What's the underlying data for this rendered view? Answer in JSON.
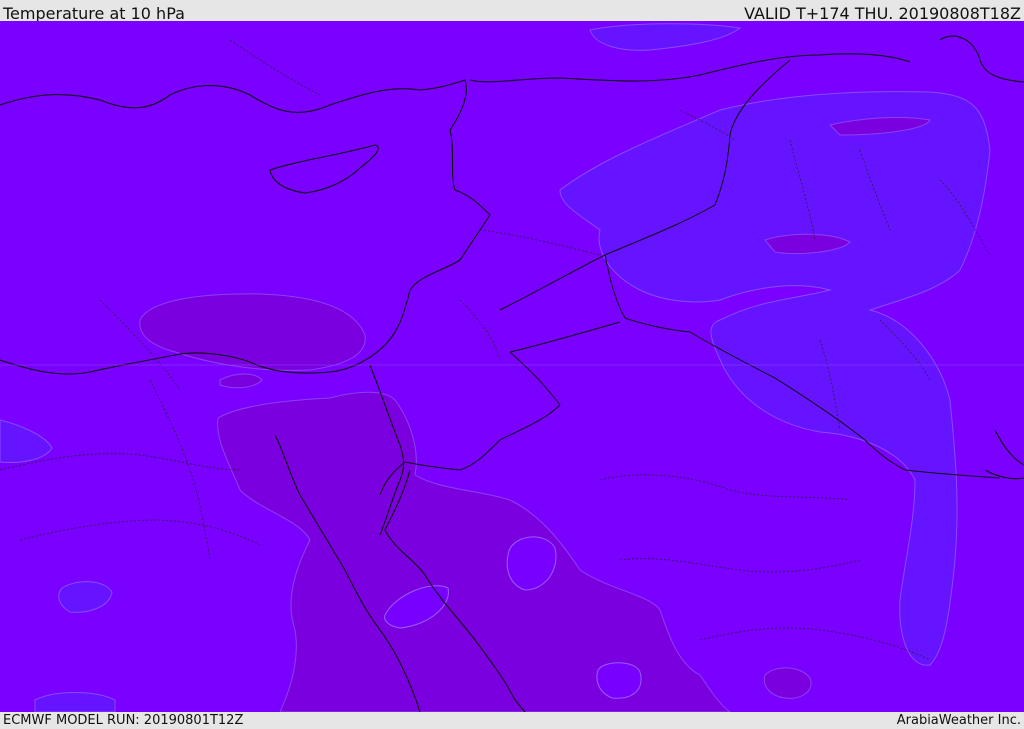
{
  "header": {
    "title": "Temperature at 10 hPa",
    "valid": "VALID T+174 THU. 20190808T18Z"
  },
  "footer": {
    "model_run": "ECMWF MODEL RUN: 20190801T12Z",
    "credit": "ArabiaWeather Inc."
  },
  "map": {
    "colors": {
      "base_field": "#7a00ff",
      "cooler_field": "#6515ff",
      "warmer_field": "#7b00e0",
      "coastline": "#111111",
      "borders": "#222222"
    }
  }
}
